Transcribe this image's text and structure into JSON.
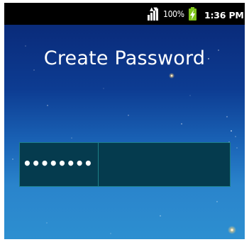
{
  "status_bar": {
    "battery_percent": "100%",
    "time": "1:36 PM",
    "battery_color": "#7fc51b",
    "icons": [
      "signal-icon",
      "battery-charging-icon"
    ]
  },
  "screen": {
    "title": "Create Password",
    "password_mask": "••••••••"
  },
  "colors": {
    "input_background": "#053b4e",
    "input_border": "#1d7f86",
    "wallpaper_top": "#0a2b7a",
    "wallpaper_bottom": "#2d8fd0"
  }
}
